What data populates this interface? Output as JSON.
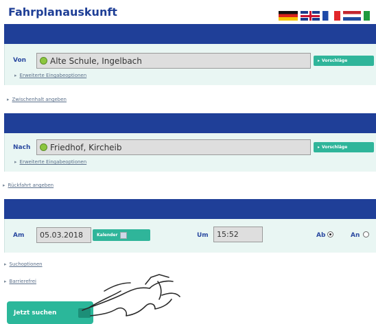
{
  "header": {
    "title": "Fahrplanauskunft"
  },
  "languages": [
    "flag-de",
    "flag-uk",
    "flag-fr",
    "flag-nl",
    "flag-it"
  ],
  "from": {
    "label": "Von",
    "value": "Alte Schule, Ingelbach",
    "button": "Vorschläge",
    "advanced_link": "Erweiterte Eingabeoptionen"
  },
  "via_link": "Zwischenhalt angeben",
  "to": {
    "label": "Nach",
    "value": "Friedhof, Kircheib",
    "button": "Vorschläge",
    "advanced_link": "Erweiterte Eingabeoptionen"
  },
  "return_link": "Rückfahrt angeben",
  "datetime": {
    "date_label": "Am",
    "date_value": "05.03.2018",
    "calendar_button": "Kalender",
    "time_label": "Um",
    "time_value": "15:52",
    "departure_label": "Ab",
    "arrival_label": "An",
    "selected": "departure"
  },
  "extra_links": [
    "Suchoptionen",
    "Barrierefrei"
  ],
  "submit": {
    "label": "Jetzt suchen"
  },
  "colors": {
    "bar": "#1f3f98",
    "panel": "#e9f6f3",
    "accent": "#2fb59a",
    "title": "#1f3f96"
  }
}
